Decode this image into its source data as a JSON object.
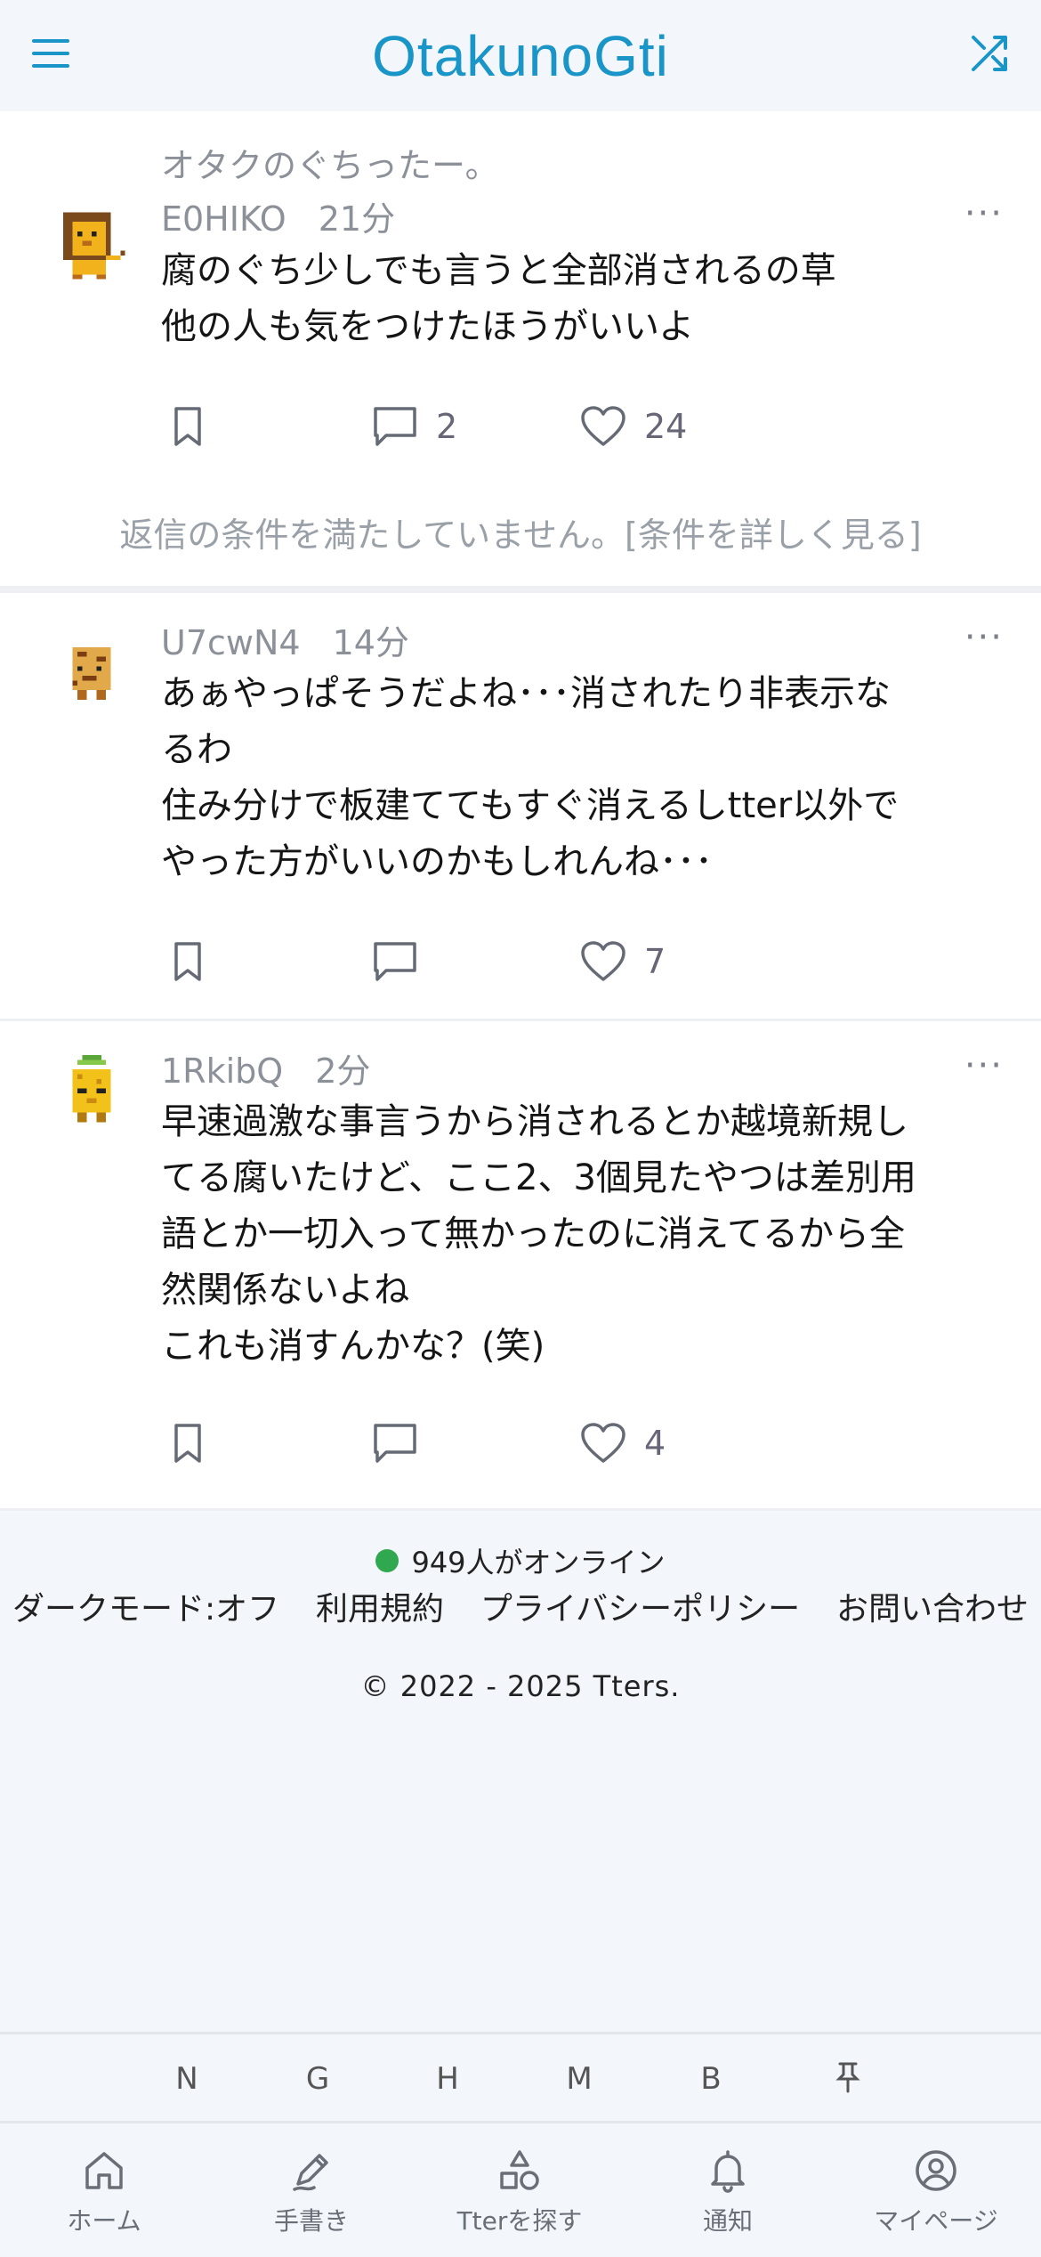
{
  "app": {
    "title": "OtakunoGti"
  },
  "feed": {
    "community_name": "オタクのぐちったー。",
    "reply_condition": "返信の条件を満たしていません。[条件を詳しく見る]",
    "posts": [
      {
        "user": "E0HIKO",
        "time": "21分",
        "lines": [
          "腐のぐち少しでも言うと全部消されるの草",
          "他の人も気をつけたほうがいいよ"
        ],
        "replies": "2",
        "likes": "24",
        "avatar_icon": "lion-pixel-avatar"
      },
      {
        "user": "U7cwN4",
        "time": "14分",
        "lines": [
          "あぁやっぱそうだよね･･･消されたり非表示な",
          "るわ",
          "住み分けで板建ててもすぐ消えるしtter以外で",
          "やった方がいいのかもしれんね･･･"
        ],
        "replies": "",
        "likes": "7",
        "avatar_icon": "cookie-pixel-avatar"
      },
      {
        "user": "1RkibQ",
        "time": "2分",
        "lines": [
          "早速過激な事言うから消されるとか越境新規し",
          "てる腐いたけど、ここ2、3個見たやつは差別用",
          "語とか一切入って無かったのに消えてるから全",
          "然関係ないよね",
          "これも消すんかな？(笑)"
        ],
        "replies": "",
        "likes": "4",
        "avatar_icon": "pineapple-pixel-avatar"
      }
    ],
    "more_glyph": "···"
  },
  "footer": {
    "online": "949人がオンライン",
    "links": [
      "ダークモード:オフ",
      "利用規約",
      "プライバシーポリシー",
      "お問い合わせ"
    ],
    "copyright": "© 2022 - 2025 Tters."
  },
  "quickbar": {
    "items": [
      "N",
      "G",
      "H",
      "M",
      "B"
    ],
    "pin_icon": "pin-icon"
  },
  "tabbar": {
    "items": [
      {
        "label": "ホーム",
        "icon": "home-icon"
      },
      {
        "label": "手書き",
        "icon": "pencil-icon"
      },
      {
        "label": "Tterを探す",
        "icon": "shapes-icon"
      },
      {
        "label": "通知",
        "icon": "bell-icon"
      },
      {
        "label": "マイページ",
        "icon": "user-circle-icon"
      }
    ]
  },
  "colors": {
    "accent": "#1a95c8",
    "online": "#2fa84f",
    "background": "#f3f6fb"
  }
}
